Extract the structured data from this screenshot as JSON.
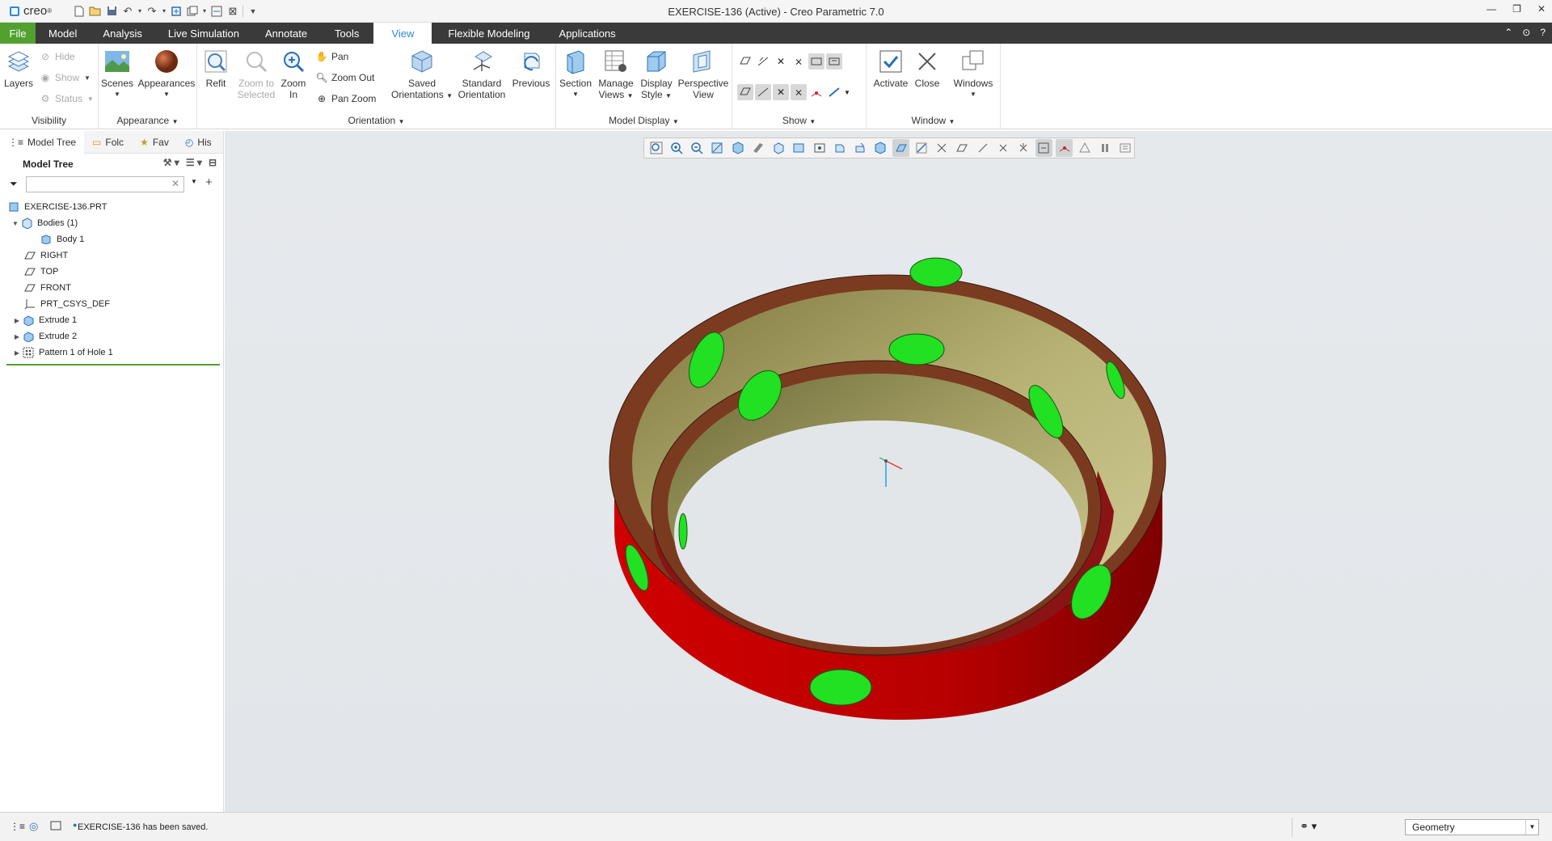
{
  "app": {
    "logo_text": "creo",
    "window_title": "EXERCISE-136 (Active) - Creo Parametric 7.0"
  },
  "tabs": [
    {
      "label": "File"
    },
    {
      "label": "Model"
    },
    {
      "label": "Analysis"
    },
    {
      "label": "Live Simulation"
    },
    {
      "label": "Annotate"
    },
    {
      "label": "Tools"
    },
    {
      "label": "View"
    },
    {
      "label": "Flexible Modeling"
    },
    {
      "label": "Applications"
    }
  ],
  "active_tab": "View",
  "ribbon": {
    "visibility": {
      "group": "Visibility",
      "layers": "Layers",
      "hide": "Hide",
      "show": "Show",
      "status": "Status"
    },
    "appearance": {
      "group": "Appearance",
      "scenes": "Scenes",
      "appearances": "Appearances"
    },
    "orientation": {
      "group": "Orientation",
      "refit": "Refit",
      "zoom_selected_1": "Zoom to",
      "zoom_selected_2": "Selected",
      "zoom_in_1": "Zoom",
      "zoom_in_2": "In",
      "pan": "Pan",
      "zoom_out": "Zoom Out",
      "pan_zoom": "Pan Zoom",
      "saved_1": "Saved",
      "saved_2": "Orientations",
      "standard_1": "Standard",
      "standard_2": "Orientation",
      "previous": "Previous"
    },
    "model_display": {
      "group": "Model Display",
      "section": "Section",
      "manage_1": "Manage",
      "manage_2": "Views",
      "display_1": "Display",
      "display_2": "Style",
      "perspective_1": "Perspective",
      "perspective_2": "View"
    },
    "show": {
      "group": "Show"
    },
    "window": {
      "group": "Window",
      "activate": "Activate",
      "close": "Close",
      "windows": "Windows"
    }
  },
  "navigator": {
    "tabs": [
      "Model Tree",
      "Folc",
      "Fav",
      "His"
    ],
    "tree_title": "Model Tree",
    "filter_placeholder": ""
  },
  "tree_items": [
    {
      "label": "EXERCISE-136.PRT"
    },
    {
      "label": "Bodies (1)"
    },
    {
      "label": "Body 1"
    },
    {
      "label": "RIGHT"
    },
    {
      "label": "TOP"
    },
    {
      "label": "FRONT"
    },
    {
      "label": "PRT_CSYS_DEF"
    },
    {
      "label": "Extrude 1"
    },
    {
      "label": "Extrude 2"
    },
    {
      "label": "Pattern 1 of Hole 1"
    }
  ],
  "status": {
    "message": "EXERCISE-136 has been saved.",
    "selection_filter": "Geometry"
  },
  "colors": {
    "file_tab": "#52a12f",
    "tab_bar": "#3a3a3a",
    "active_tab_text": "#2a8ad8",
    "model_outer_side": "#c40000",
    "model_inner_face": "#a8a56a",
    "model_rim": "#7a3a22",
    "model_hole": "#22e022",
    "background": "#e4e7ea"
  }
}
